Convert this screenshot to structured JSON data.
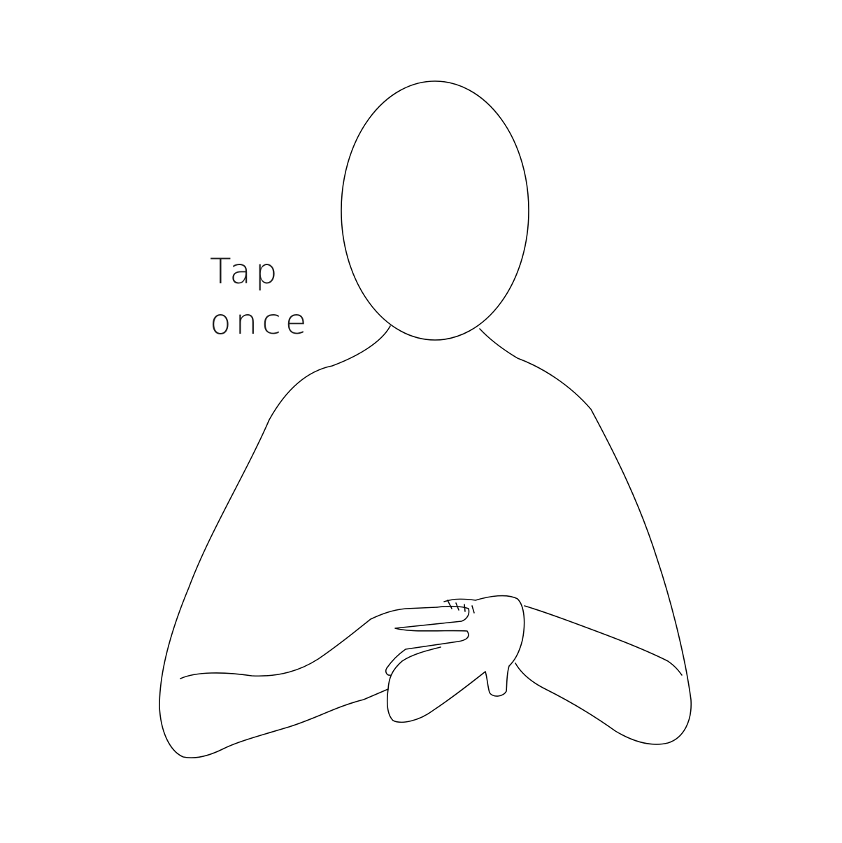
{
  "caption": {
    "line1": "Tap",
    "line2": "once"
  },
  "colors": {
    "background": "#ffffff",
    "stroke": "#000000"
  },
  "icons": [
    "head-outline",
    "torso-outline",
    "left-hand",
    "right-hand"
  ]
}
